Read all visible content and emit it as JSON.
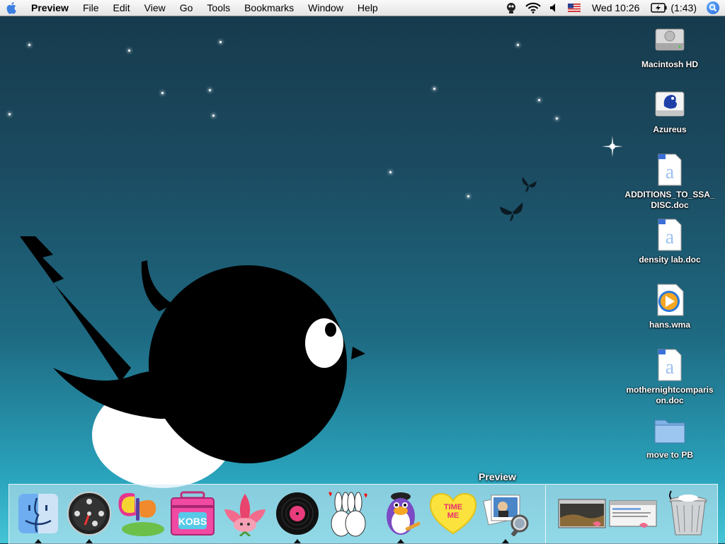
{
  "menubar": {
    "app_name": "Preview",
    "menus": [
      "File",
      "Edit",
      "View",
      "Go",
      "Tools",
      "Bookmarks",
      "Window",
      "Help"
    ],
    "clock": "Wed 10:26",
    "battery": "(1:43)"
  },
  "desktop_icons": [
    {
      "label": "Macintosh HD",
      "icon": "hard-drive-icon"
    },
    {
      "label": "Azureus",
      "icon": "azureus-disk-icon"
    },
    {
      "label": "ADDITIONS_TO_SSA_\nDISC.doc",
      "icon": "word-document-icon"
    },
    {
      "label": "density lab.doc",
      "icon": "word-document-icon"
    },
    {
      "label": "hans.wma",
      "icon": "media-file-icon"
    },
    {
      "label": "mothernightcomparis\non.doc",
      "icon": "word-document-icon"
    },
    {
      "label": "move to PB",
      "icon": "folder-icon"
    }
  ],
  "dock": {
    "tooltip": "Preview",
    "items": [
      {
        "name": "finder",
        "icon": "finder-icon"
      },
      {
        "name": "dashboard",
        "icon": "dashboard-icon"
      },
      {
        "name": "butterfly-app",
        "icon": "butterfly-icon"
      },
      {
        "name": "kobe-box",
        "icon": "toolbox-icon"
      },
      {
        "name": "flower-app",
        "icon": "flower-icon"
      },
      {
        "name": "record-app",
        "icon": "vinyl-record-icon"
      },
      {
        "name": "bunnies-app",
        "icon": "bunnies-icon"
      },
      {
        "name": "penguin-app",
        "icon": "penguin-icon"
      },
      {
        "name": "candy-heart",
        "icon": "candy-heart-icon",
        "text": "TIME ME"
      },
      {
        "name": "preview",
        "icon": "preview-icon"
      }
    ]
  }
}
